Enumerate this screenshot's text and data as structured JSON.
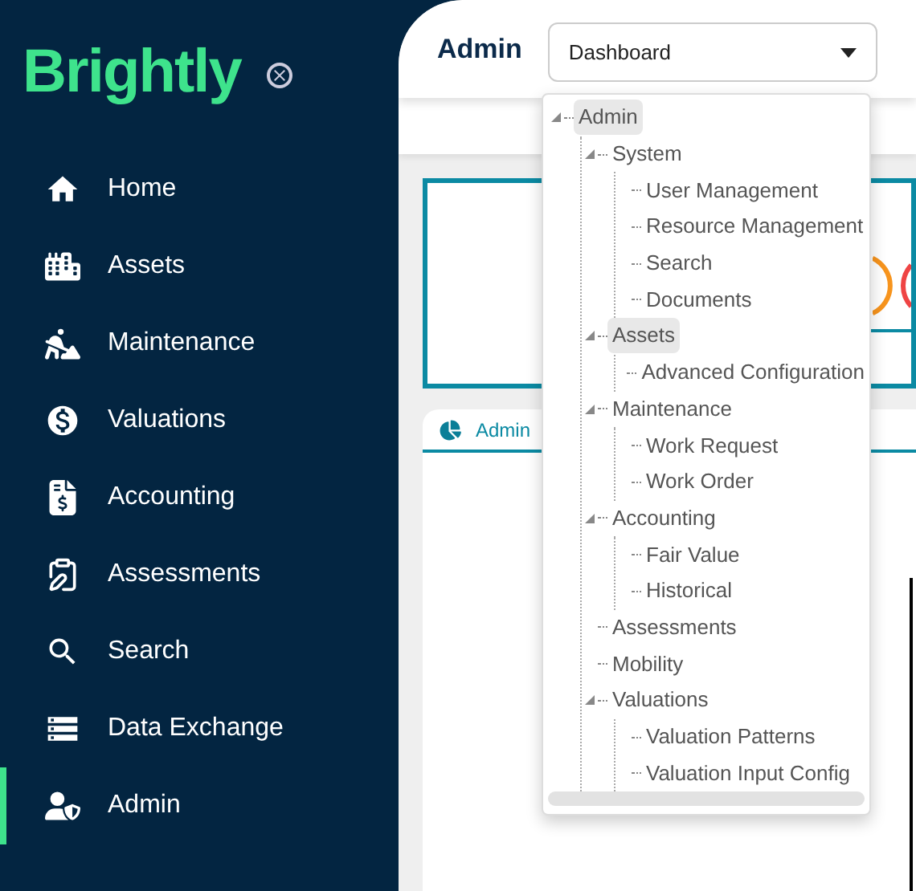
{
  "sidebar": {
    "logo": "Brightly",
    "items": [
      {
        "label": "Home",
        "selected": false
      },
      {
        "label": "Assets",
        "selected": false
      },
      {
        "label": "Maintenance",
        "selected": false
      },
      {
        "label": "Valuations",
        "selected": false
      },
      {
        "label": "Accounting",
        "selected": false
      },
      {
        "label": "Assessments",
        "selected": false
      },
      {
        "label": "Search",
        "selected": false
      },
      {
        "label": "Data Exchange",
        "selected": false
      },
      {
        "label": "Admin",
        "selected": true
      }
    ]
  },
  "header": {
    "title": "Admin",
    "select": {
      "value": "Dashboard"
    }
  },
  "dropdown_tree": [
    {
      "label": "Admin",
      "selected": true,
      "expanded": true,
      "children": [
        {
          "label": "System",
          "selected": false,
          "expanded": true,
          "children": [
            {
              "label": "User Management",
              "selected": false
            },
            {
              "label": "Resource Management",
              "selected": false
            },
            {
              "label": "Search",
              "selected": false
            },
            {
              "label": "Documents",
              "selected": false
            }
          ]
        },
        {
          "label": "Assets",
          "selected": true,
          "expanded": true,
          "children": [
            {
              "label": "Advanced Configuration",
              "selected": false
            }
          ]
        },
        {
          "label": "Maintenance",
          "selected": false,
          "expanded": true,
          "children": [
            {
              "label": "Work Request",
              "selected": false
            },
            {
              "label": "Work Order",
              "selected": false
            }
          ]
        },
        {
          "label": "Accounting",
          "selected": false,
          "expanded": true,
          "children": [
            {
              "label": "Fair Value",
              "selected": false
            },
            {
              "label": "Historical",
              "selected": false
            }
          ]
        },
        {
          "label": "Assessments",
          "selected": false
        },
        {
          "label": "Mobility",
          "selected": false
        },
        {
          "label": "Valuations",
          "selected": false,
          "expanded": true,
          "children": [
            {
              "label": "Valuation Patterns",
              "selected": false
            },
            {
              "label": "Valuation Input Config",
              "selected": false
            }
          ]
        }
      ]
    }
  ],
  "widget": {
    "title": "Admin"
  }
}
